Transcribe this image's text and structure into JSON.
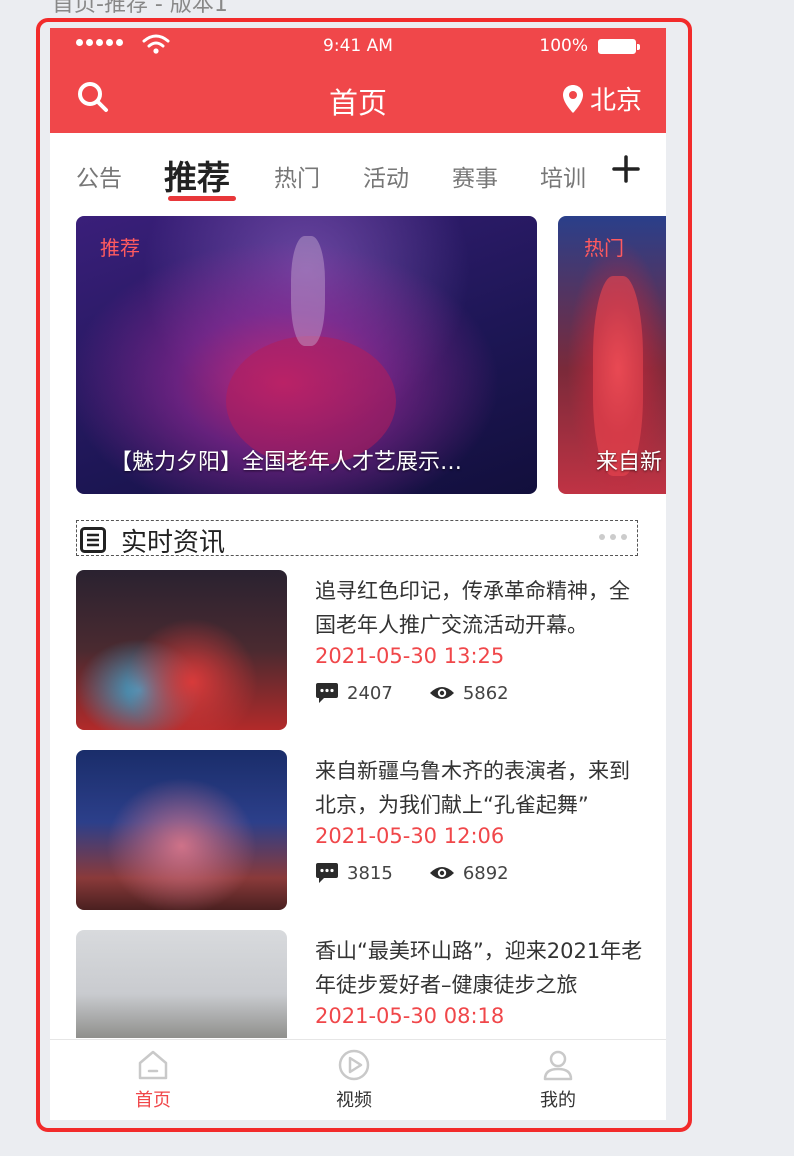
{
  "page_caption": "首页-推荐 - 版本1",
  "status_bar": {
    "time": "9:41 AM",
    "battery": "100%"
  },
  "header": {
    "title": "首页",
    "location": "北京"
  },
  "tabs": [
    {
      "label": "公告",
      "active": false
    },
    {
      "label": "推荐",
      "active": true
    },
    {
      "label": "热门",
      "active": false
    },
    {
      "label": "活动",
      "active": false
    },
    {
      "label": "赛事",
      "active": false
    },
    {
      "label": "培训",
      "active": false
    }
  ],
  "carousel": [
    {
      "tag": "推荐",
      "caption": "【魅力夕阳】全国老年人才艺展示…"
    },
    {
      "tag": "热门",
      "caption": "来自新"
    }
  ],
  "section": {
    "title": "实时资讯"
  },
  "news": [
    {
      "title": "追寻红色印记，传承革命精神，全国老年人推广交流活动开幕。",
      "date": "2021-05-30 13:25",
      "comments": "2407",
      "views": "5862"
    },
    {
      "title": "来自新疆乌鲁木齐的表演者，来到北京，为我们献上“孔雀起舞”",
      "date": "2021-05-30 12:06",
      "comments": "3815",
      "views": "6892"
    },
    {
      "title": "香山“最美环山路”，迎来2021年老年徒步爱好者–健康徒步之旅",
      "date": "2021-05-30 08:18",
      "comments": "",
      "views": ""
    }
  ],
  "tabbar": [
    {
      "label": "首页",
      "icon": "home-icon",
      "active": true
    },
    {
      "label": "视频",
      "icon": "play-circle-icon",
      "active": false
    },
    {
      "label": "我的",
      "icon": "user-icon",
      "active": false
    }
  ],
  "colors": {
    "accent": "#f0474a",
    "frame_outline": "#f22b2b"
  }
}
